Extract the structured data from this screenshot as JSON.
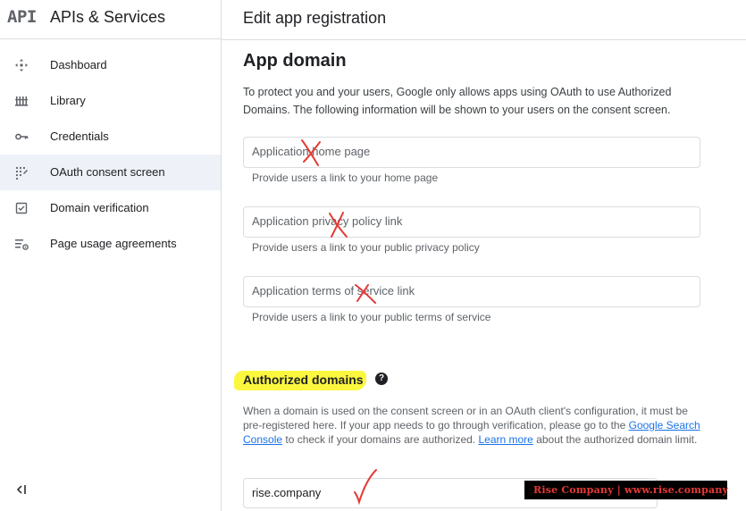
{
  "brand": {
    "logo_text": "API",
    "title": "APIs & Services"
  },
  "nav": {
    "items": [
      {
        "label": "Dashboard",
        "icon": "dashboard-icon",
        "active": false
      },
      {
        "label": "Library",
        "icon": "library-icon",
        "active": false
      },
      {
        "label": "Credentials",
        "icon": "key-icon",
        "active": false
      },
      {
        "label": "OAuth consent screen",
        "icon": "oauth-consent-icon",
        "active": true
      },
      {
        "label": "Domain verification",
        "icon": "checkbox-icon",
        "active": false
      },
      {
        "label": "Page usage agreements",
        "icon": "settings-list-icon",
        "active": false
      }
    ],
    "collapse_icon": "collapse-sidebar-icon"
  },
  "header": {
    "title": "Edit app registration"
  },
  "app_domain": {
    "heading": "App domain",
    "intro": "To protect you and your users, Google only allows apps using OAuth to use Authorized Domains. The following information will be shown to your users on the consent screen.",
    "fields": [
      {
        "placeholder": "Application home page",
        "value": "",
        "hint": "Provide users a link to your home page"
      },
      {
        "placeholder": "Application privacy policy link",
        "value": "",
        "hint": "Provide users a link to your public privacy policy"
      },
      {
        "placeholder": "Application terms of service link",
        "value": "",
        "hint": "Provide users a link to your public terms of service"
      }
    ]
  },
  "authorized_domains": {
    "heading": "Authorized domains",
    "help_icon": "help-icon",
    "desc_part1": "When a domain is used on the consent screen or in an OAuth client's configuration, it must be pre-registered here. If your app needs to go through verification, please go to the ",
    "link_search_console": "Google Search Console",
    "desc_part2": " to check if your domains are authorized. ",
    "link_learn_more": "Learn more",
    "desc_part3": " about the authorized domain limit.",
    "domain_value": "rise.company"
  },
  "annotations": {
    "cross_color": "#e53935",
    "check_color": "#e53935",
    "highlight_color": "#fbf73e"
  },
  "watermark": {
    "text": "Rise Company | www.rise.company"
  }
}
